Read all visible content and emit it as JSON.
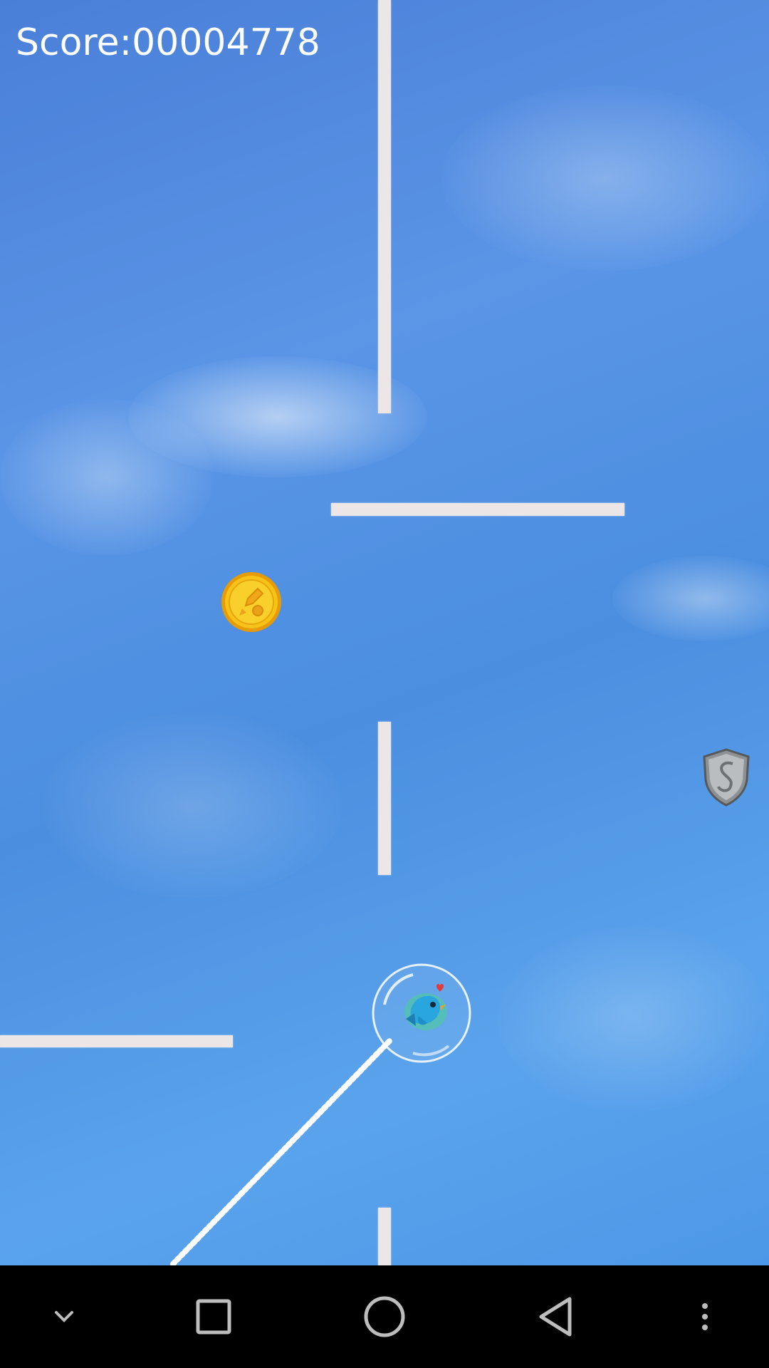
{
  "hud": {
    "score_text": "Score:00004778"
  },
  "game": {
    "items": {
      "coin_icon": "rocket-coin-icon",
      "shield_icon": "shield-powerup-icon",
      "player_icon": "bird-in-bubble-icon"
    },
    "colors": {
      "sky": "#4b8ee0",
      "bar": "#ece6e6",
      "coin": "#f5b60f"
    }
  },
  "navbar": {
    "buttons": [
      {
        "icon": "chevron-down-icon"
      },
      {
        "icon": "recents-square-icon"
      },
      {
        "icon": "home-circle-icon"
      },
      {
        "icon": "back-triangle-icon"
      },
      {
        "icon": "more-vertical-icon"
      }
    ]
  }
}
